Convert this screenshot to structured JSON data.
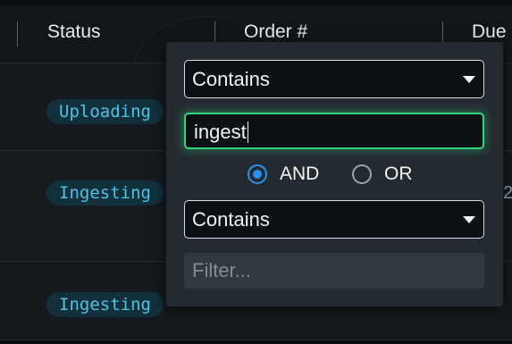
{
  "table": {
    "columns": [
      {
        "label": "Status"
      },
      {
        "label": "Order #"
      },
      {
        "label": "Due"
      }
    ],
    "rows": [
      {
        "status": "Uploading",
        "edge_text": ""
      },
      {
        "status": "Ingesting",
        "edge_text": "2"
      },
      {
        "status": "Ingesting",
        "edge_text": ""
      }
    ]
  },
  "filter_popup": {
    "first_condition": {
      "operator": "Contains",
      "value": "ingest"
    },
    "join": {
      "options": [
        {
          "label": "AND",
          "selected": true
        },
        {
          "label": "OR",
          "selected": false
        }
      ]
    },
    "second_condition": {
      "operator": "Contains",
      "value": "",
      "placeholder": "Filter..."
    }
  },
  "colors": {
    "badge_text": "#4ec3e4",
    "focus_ring": "#2fd67d",
    "radio_selected": "#2d8ef0"
  }
}
